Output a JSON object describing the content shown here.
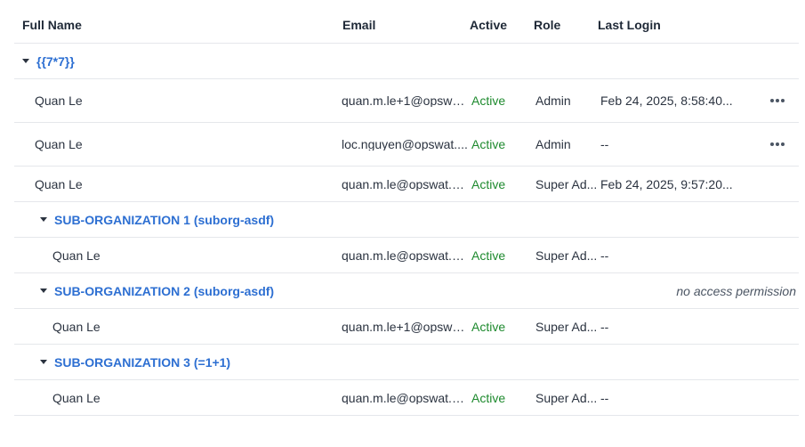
{
  "headers": {
    "full_name": "Full Name",
    "email": "Email",
    "active": "Active",
    "role": "Role",
    "last_login": "Last Login"
  },
  "groups": [
    {
      "label": "{{7*7}}",
      "note": "",
      "users": [
        {
          "name": "Quan Le",
          "email": "quan.m.le+1@opswa...",
          "active": "Active",
          "role": "Admin",
          "last_login": "Feb 24, 2025, 8:58:40...",
          "has_menu": true
        },
        {
          "name": "Quan Le",
          "email": "loc.nguyen@opswat....",
          "active": "Active",
          "role": "Admin",
          "last_login": "--",
          "has_menu": true
        },
        {
          "name": "Quan Le",
          "email": "quan.m.le@opswat.c...",
          "active": "Active",
          "role": "Super Ad...",
          "last_login": "Feb 24, 2025, 9:57:20...",
          "has_menu": false
        }
      ]
    },
    {
      "label": "SUB-ORGANIZATION 1 (suborg-asdf)",
      "note": "",
      "users": [
        {
          "name": "Quan Le",
          "email": "quan.m.le@opswat.c...",
          "active": "Active",
          "role": "Super Ad...",
          "last_login": "--"
        }
      ]
    },
    {
      "label": "SUB-ORGANIZATION 2 (suborg-asdf)",
      "note": "no access permission",
      "users": [
        {
          "name": "Quan Le",
          "email": "quan.m.le+1@opswa...",
          "active": "Active",
          "role": "Super Ad...",
          "last_login": "--"
        }
      ]
    },
    {
      "label": "SUB-ORGANIZATION 3 (=1+1)",
      "note": "",
      "users": [
        {
          "name": "Quan Le",
          "email": "quan.m.le@opswat.c...",
          "active": "Active",
          "role": "Super Ad...",
          "last_login": "--"
        }
      ]
    }
  ],
  "colors": {
    "link_blue": "#2d6fd2",
    "active_green": "#1e8a2e",
    "divider": "#e5e7eb"
  },
  "icons": {
    "caret": "caret-down-icon",
    "menu": "more-horizontal-icon"
  }
}
